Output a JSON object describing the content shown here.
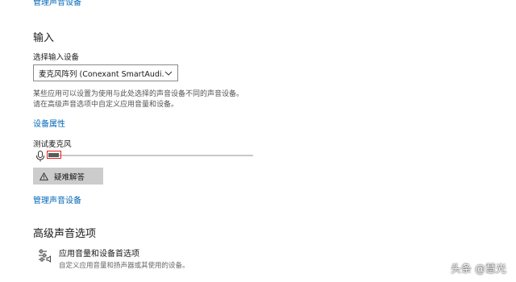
{
  "top": {
    "manage_link": "管理声音设备"
  },
  "input": {
    "title": "输入",
    "device_label": "选择输入设备",
    "device_value": "麦克风阵列 (Conexant SmartAudi...",
    "description_line1": "某些应用可以设置为使用与此处选择的声音设备不同的声音设备。",
    "description_line2": "请在高级声音选项中自定义应用音量和设备。",
    "device_properties_link": "设备属性",
    "test_label": "测试麦克风",
    "mic_level": 0.05,
    "troubleshoot_label": "疑难解答",
    "manage_link": "管理声音设备"
  },
  "advanced": {
    "title": "高级声音选项",
    "app_volume_title": "应用音量和设备首选项",
    "app_volume_desc": "自定义应用音量和扬声器或其使用的设备。"
  },
  "watermark": "头条 @慧光",
  "icons": {
    "mic": "microphone-icon",
    "warning": "warning-icon",
    "chevron": "chevron-down-icon",
    "app_volume": "sliders-speaker-icon"
  },
  "colors": {
    "link": "#0067b8",
    "highlight": "#e02020",
    "button_bg": "#cccccc"
  }
}
